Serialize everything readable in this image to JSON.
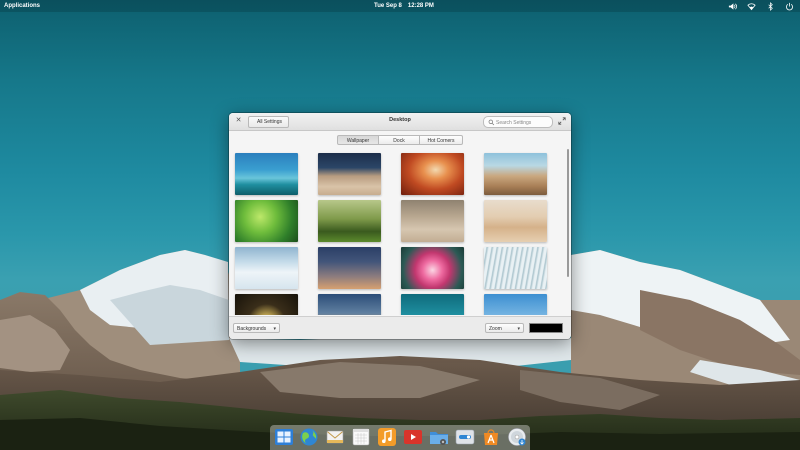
{
  "panel": {
    "applications": "Applications",
    "date": "Tue Sep 8",
    "time": "12:28 PM",
    "tray_icons": [
      "volume-icon",
      "wifi-icon",
      "bluetooth-icon",
      "power-icon"
    ]
  },
  "window": {
    "title": "Desktop",
    "back_button": "All Settings",
    "search_placeholder": "Search Settings",
    "tabs": [
      {
        "label": "Wallpaper",
        "active": true
      },
      {
        "label": "Dock",
        "active": false
      },
      {
        "label": "Hot Corners",
        "active": false
      }
    ],
    "wallpapers": [
      "tropical-water",
      "rippled-sand",
      "red-rock-canyon",
      "rocky-shore",
      "green-leaves",
      "bench-in-grass",
      "seashell-on-beach",
      "sand-dunes",
      "clouds",
      "dusk-sky",
      "pink-lotus",
      "ribbed-texture",
      "round-window",
      "sunset-lake",
      "teal-water",
      "blue-sky"
    ],
    "background_mode": "Backgrounds",
    "fit_mode": "Zoom",
    "solid_color": "#000000"
  },
  "dock": {
    "apps": [
      "multitasking-view",
      "web-browser",
      "mail",
      "calendar",
      "music",
      "videos",
      "files",
      "system-settings",
      "app-center",
      "optical-disc"
    ]
  }
}
